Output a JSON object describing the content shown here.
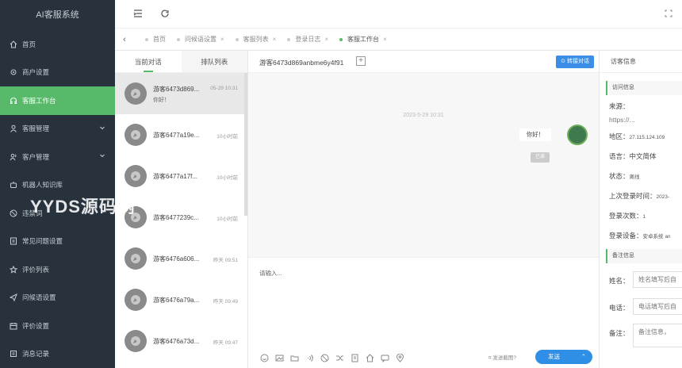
{
  "app": {
    "title": "AI客服系统"
  },
  "sidebar": {
    "items": [
      {
        "label": "首页",
        "icon": "home-icon",
        "active": false
      },
      {
        "label": "商户设置",
        "icon": "gear-icon",
        "active": false
      },
      {
        "label": "客服工作台",
        "icon": "headset-icon",
        "active": true
      },
      {
        "label": "客服管理",
        "icon": "user-icon",
        "active": false,
        "expandable": true
      },
      {
        "label": "客户管理",
        "icon": "users-icon",
        "active": false,
        "expandable": true
      },
      {
        "label": "机器人知识库",
        "icon": "robot-icon",
        "active": false
      },
      {
        "label": "违禁词",
        "icon": "ban-icon",
        "active": false
      },
      {
        "label": "常见问题设置",
        "icon": "help-icon",
        "active": false
      },
      {
        "label": "评价列表",
        "icon": "star-icon",
        "active": false
      },
      {
        "label": "问候语设置",
        "icon": "send-icon",
        "active": false
      },
      {
        "label": "评价设置",
        "icon": "calendar-icon",
        "active": false
      },
      {
        "label": "消息记录",
        "icon": "record-icon",
        "active": false
      }
    ]
  },
  "tabs": [
    {
      "label": "首页",
      "active": false,
      "closable": false
    },
    {
      "label": "问候语设置",
      "active": false,
      "closable": true
    },
    {
      "label": "客服列表",
      "active": false,
      "closable": true
    },
    {
      "label": "登录日志",
      "active": false,
      "closable": true
    },
    {
      "label": "客服工作台",
      "active": true,
      "closable": true
    }
  ],
  "conversations": {
    "tabs": [
      "当前对话",
      "排队列表"
    ],
    "items": [
      {
        "name": "游客6473d869...",
        "time": "05-29 10:31",
        "message": "你好！",
        "selected": true
      },
      {
        "name": "游客6477a19e...",
        "time": "10小时前",
        "message": "",
        "selected": false
      },
      {
        "name": "游客6477a17f...",
        "time": "10小时前",
        "message": "",
        "selected": false
      },
      {
        "name": "游客6477239c...",
        "time": "10小时前",
        "message": "",
        "selected": false
      },
      {
        "name": "游客6476a606...",
        "time": "昨天 09:51",
        "message": "",
        "selected": false
      },
      {
        "name": "游客6476a79a...",
        "time": "昨天 09:49",
        "message": "",
        "selected": false
      },
      {
        "name": "游客6476a73d...",
        "time": "昨天 09:47",
        "message": "",
        "selected": false
      }
    ]
  },
  "chat": {
    "title": "游客6473d869anbme6y4f91",
    "transfer_label": "转接对话",
    "date": "2023-5-29 10:31",
    "message": "你好！",
    "read_tag": "已读",
    "input_placeholder": "请输入...",
    "screenshot_label": "发送截图?",
    "send_label": "发送"
  },
  "info": {
    "tab": "访客信息",
    "visit_section": "访问信息",
    "source_label": "来源：",
    "source_value": "https://...",
    "region_label": "地区：",
    "region_value": "27.115.124.109",
    "language_label": "语言：",
    "language_value": "中文简体",
    "status_label": "状态：",
    "status_value": "离线",
    "last_login_label": "上次登录时间：",
    "last_login_value": "2023-",
    "login_count_label": "登录次数：",
    "login_count_value": "1",
    "device_label": "登录设备：",
    "device_value": "安卓系统 an",
    "notes_section": "备注信息",
    "name_label": "姓名：",
    "name_placeholder": "姓名填写后自",
    "phone_label": "电话：",
    "phone_placeholder": "电话填写后自",
    "remark_label": "备注：",
    "remark_placeholder": "备注信息，"
  },
  "watermark": "YYDS源码网",
  "colors": {
    "accent": "#58b96a",
    "sidebar_bg": "#27323c",
    "primary_button": "#2f8ee5"
  }
}
